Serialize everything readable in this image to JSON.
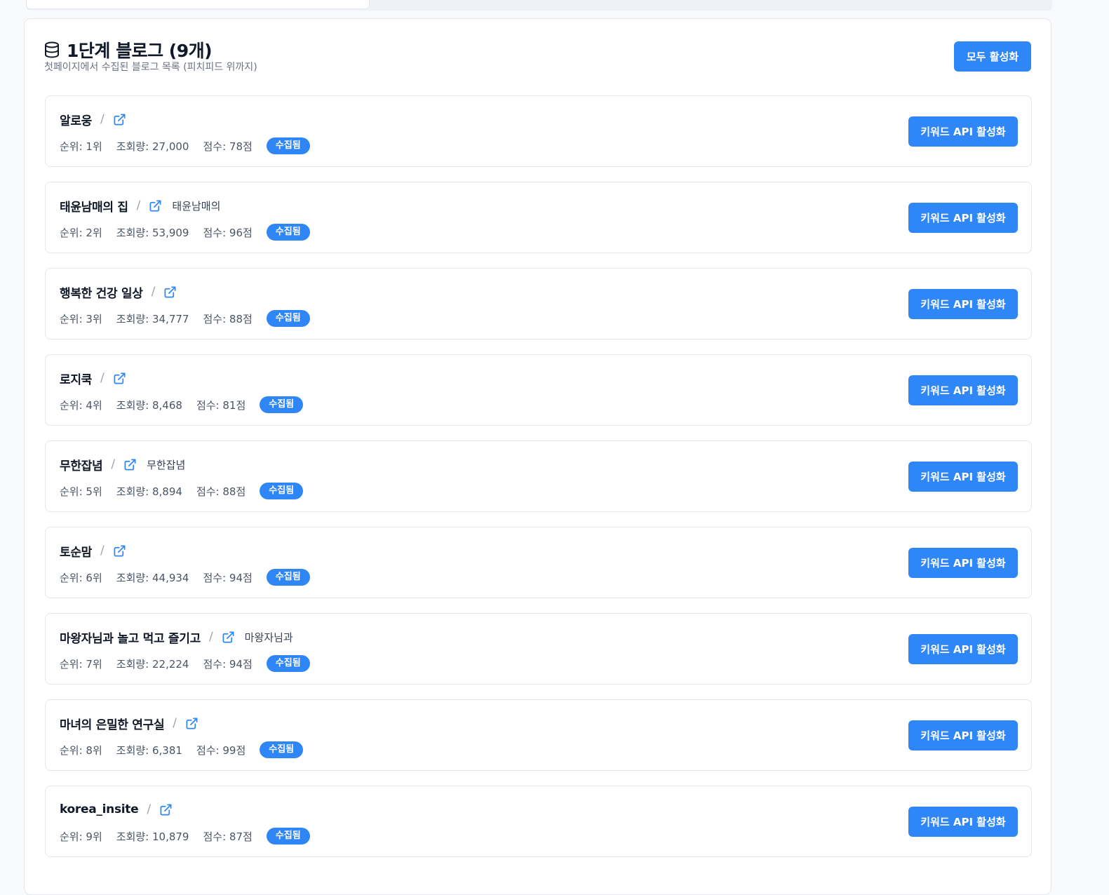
{
  "panel": {
    "title": "1단계 블로그 (9개)",
    "subtitle": "첫페이지에서 수집된 블로그 목록 (피치피드 위까지)",
    "activate_all_label": "모두 활성화",
    "title_icon": "database-icon"
  },
  "labels": {
    "rank_prefix": "순위: ",
    "views_prefix": "조회량: ",
    "score_prefix": "점수: ",
    "separator": "/",
    "keyword_button": "키워드 API 활성화"
  },
  "colors": {
    "accent": "#2f86f6"
  },
  "blogs": [
    {
      "name": "알로웅",
      "nickname": "",
      "rank": "순위: 1위",
      "views": "조회량: 27,000",
      "score": "점수: 78점",
      "status": "수집됨"
    },
    {
      "name": "태윤남매의 집",
      "nickname": "태윤남매의",
      "rank": "순위: 2위",
      "views": "조회량: 53,909",
      "score": "점수: 96점",
      "status": "수집됨"
    },
    {
      "name": "행복한 건강 일상",
      "nickname": "",
      "rank": "순위: 3위",
      "views": "조회량: 34,777",
      "score": "점수: 88점",
      "status": "수집됨"
    },
    {
      "name": "로지쿡",
      "nickname": "",
      "rank": "순위: 4위",
      "views": "조회량: 8,468",
      "score": "점수: 81점",
      "status": "수집됨"
    },
    {
      "name": "무한잡념",
      "nickname": "무한잡념",
      "rank": "순위: 5위",
      "views": "조회량: 8,894",
      "score": "점수: 88점",
      "status": "수집됨"
    },
    {
      "name": "토순맘",
      "nickname": "",
      "rank": "순위: 6위",
      "views": "조회량: 44,934",
      "score": "점수: 94점",
      "status": "수집됨"
    },
    {
      "name": "마왕자님과 놀고 먹고 즐기고",
      "nickname": "마왕자님과",
      "rank": "순위: 7위",
      "views": "조회량: 22,224",
      "score": "점수: 94점",
      "status": "수집됨"
    },
    {
      "name": "마녀의 은밀한 연구실",
      "nickname": "",
      "rank": "순위: 8위",
      "views": "조회량: 6,381",
      "score": "점수: 99점",
      "status": "수집됨"
    },
    {
      "name": "korea_insite",
      "nickname": "",
      "rank": "순위: 9위",
      "views": "조회량: 10,879",
      "score": "점수: 87점",
      "status": "수집됨"
    }
  ]
}
